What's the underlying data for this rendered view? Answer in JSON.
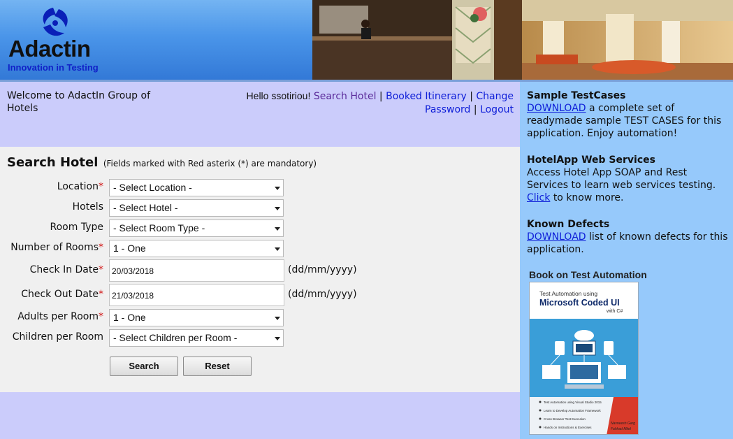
{
  "brand": {
    "name": "Adactin",
    "tagline": "Innovation in Testing"
  },
  "welcome": {
    "text": "Welcome to AdactIn Group of Hotels"
  },
  "user_nav": {
    "greeting": "Hello ssotiriou!",
    "search_hotel": "Search Hotel",
    "booked_itinerary": "Booked Itinerary",
    "change_password": "Change Password",
    "logout": "Logout",
    "separator": "|"
  },
  "form": {
    "title": "Search Hotel",
    "note": "(Fields marked with Red asterix (*) are mandatory)",
    "asterisk": "*",
    "fields": {
      "location": {
        "label": "Location",
        "value": "- Select Location -"
      },
      "hotels": {
        "label": "Hotels",
        "value": "- Select Hotel -"
      },
      "room_type": {
        "label": "Room Type",
        "value": "- Select Room Type -"
      },
      "num_rooms": {
        "label": "Number of Rooms",
        "value": "1 - One"
      },
      "check_in": {
        "label": "Check In Date",
        "value": "20/03/2018",
        "hint": "(dd/mm/yyyy)"
      },
      "check_out": {
        "label": "Check Out Date",
        "value": "21/03/2018",
        "hint": "(dd/mm/yyyy)"
      },
      "adults": {
        "label": "Adults per Room",
        "value": "1 - One"
      },
      "children": {
        "label": "Children per Room",
        "value": "- Select Children per Room -"
      }
    },
    "search_button": "Search",
    "reset_button": "Reset"
  },
  "sidebar": {
    "sample": {
      "heading": "Sample TestCases",
      "link": "DOWNLOAD",
      "text": "a complete set of readymade sample TEST CASES for this application. Enjoy automation!"
    },
    "webservices": {
      "heading": "HotelApp Web Services",
      "text": "Access Hotel App SOAP and Rest Services to learn web services testing.",
      "link": "Click",
      "text2": "to know more."
    },
    "defects": {
      "heading": "Known Defects",
      "link": "DOWNLOAD",
      "text": "list of known defects for this application."
    },
    "book": {
      "title": "Book on Test Automation",
      "cover_line1": "Test Automation using",
      "cover_line2": "Microsoft Coded UI",
      "cover_line3": "with C#",
      "bullets": [
        "Test Automation using Visual Studio 2015",
        "Learn to Develop Automation Framework",
        "Cross Browser Test Execution",
        "Hands on Instructions & Exercises"
      ],
      "authors": [
        "Navneesh Garg",
        "Fahhad Mitel"
      ]
    }
  },
  "colors": {
    "header_blue": "#4a95e9",
    "panel_lavender": "#cbccfb",
    "form_bg": "#f0f0f0",
    "sidebar_blue": "#96c9fb",
    "link_blue": "#1020d8",
    "required_red": "#d01010"
  }
}
